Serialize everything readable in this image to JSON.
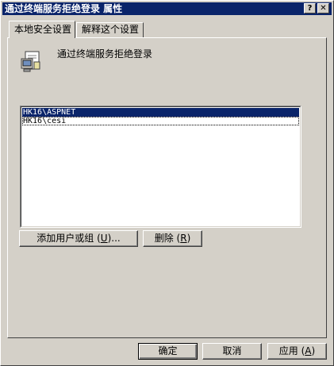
{
  "window": {
    "title": "通过终端服务拒绝登录 属性",
    "help_label": "?",
    "close_label": "✕"
  },
  "tabs": [
    {
      "label": "本地安全设置",
      "active": true
    },
    {
      "label": "解释这个设置",
      "active": false
    }
  ],
  "policy": {
    "icon": "policy-document-icon",
    "name": "通过终端服务拒绝登录"
  },
  "accounts": {
    "items": [
      {
        "label": "HK16\\ASPNET",
        "selected": true
      },
      {
        "label": "HK16\\cesi",
        "selected": false
      }
    ]
  },
  "actions": {
    "add_prefix": "添加用户或组 (",
    "add_key": "U",
    "add_suffix": ")...",
    "remove_prefix": "删除 (",
    "remove_key": "R",
    "remove_suffix": ")"
  },
  "dialog_buttons": {
    "ok": "确定",
    "cancel": "取消",
    "apply_prefix": "应用 (",
    "apply_key": "A",
    "apply_suffix": ")"
  },
  "colors": {
    "titlebar": "#0a246a",
    "face": "#d4d0c8",
    "selection": "#0a246a"
  }
}
